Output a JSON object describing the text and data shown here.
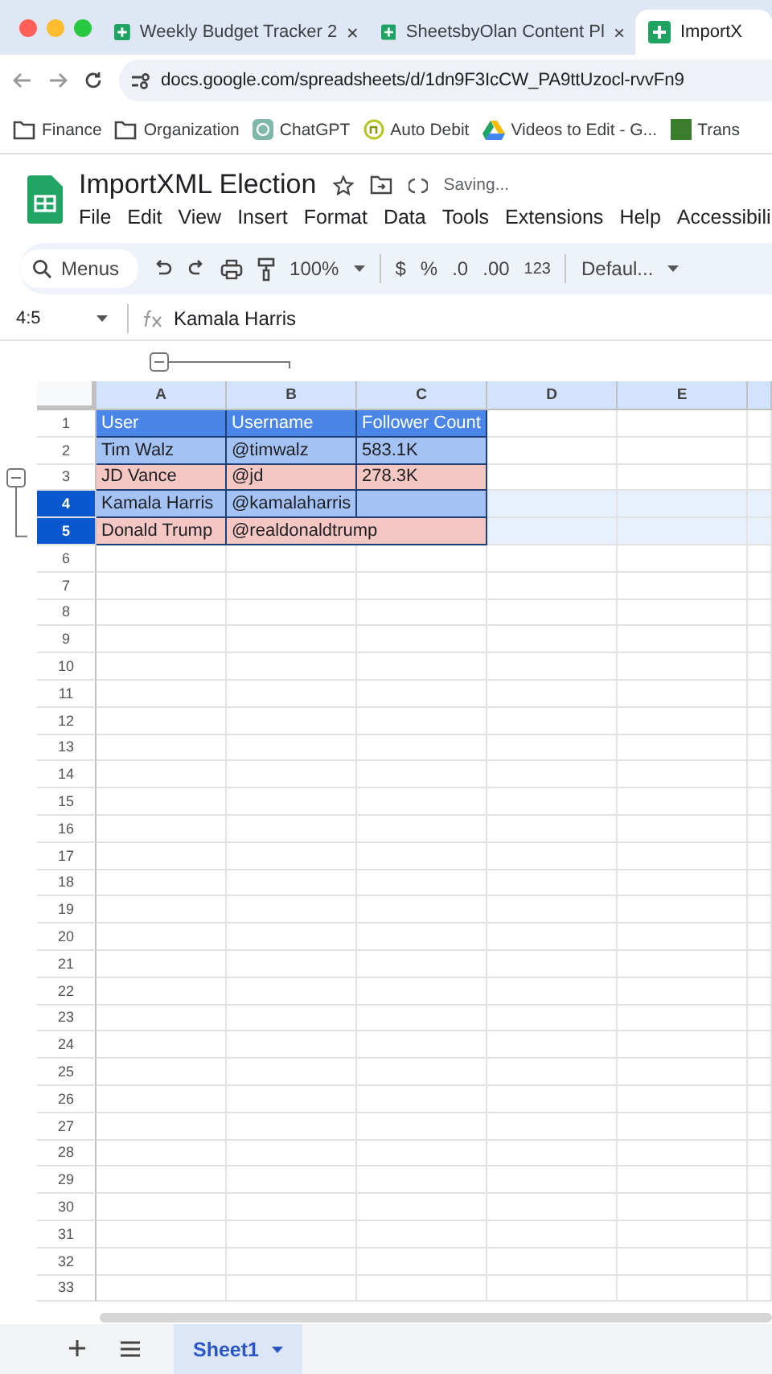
{
  "browser": {
    "tabs": [
      {
        "title": "Weekly Budget Tracker 2",
        "selected": false
      },
      {
        "title": "SheetsbyOlan Content Pl",
        "selected": false
      },
      {
        "title": "ImportX",
        "selected": true
      }
    ],
    "url": "docs.google.com/spreadsheets/d/1dn9F3IcCW_PA9ttUzocl-rvvFn9",
    "bookmarks": [
      {
        "label": "Finance",
        "kind": "folder"
      },
      {
        "label": "Organization",
        "kind": "folder"
      },
      {
        "label": "ChatGPT",
        "kind": "app"
      },
      {
        "label": "Auto Debit",
        "kind": "letter"
      },
      {
        "label": "Videos to Edit - G...",
        "kind": "drive"
      },
      {
        "label": "Trans",
        "kind": "square"
      }
    ]
  },
  "doc": {
    "title": "ImportXML Election",
    "status": "Saving...",
    "menu": [
      "File",
      "Edit",
      "View",
      "Insert",
      "Format",
      "Data",
      "Tools",
      "Extensions",
      "Help",
      "Accessibili"
    ]
  },
  "toolbar": {
    "search": "Menus",
    "zoom": "100%",
    "currency": "$",
    "percent": "%",
    "decrease_decimal": ".0",
    "increase_decimal": ".00",
    "number_format": "123",
    "font": "Defaul..."
  },
  "formula_bar": {
    "cell_ref": "4:5",
    "value": "Kamala Harris"
  },
  "grid": {
    "columns": [
      "A",
      "B",
      "C",
      "D",
      "E"
    ],
    "rows": [
      {
        "number": "1",
        "kind": "header",
        "color": "#4a86e8",
        "selected": false,
        "cells": [
          "User",
          "Username",
          "Follower Count"
        ]
      },
      {
        "number": "2",
        "kind": "data",
        "color": "#a4c2f4",
        "selected": false,
        "cells": [
          "Tim Walz",
          "@timwalz",
          "583.1K"
        ]
      },
      {
        "number": "3",
        "kind": "data",
        "color": "#f4c7c3",
        "selected": false,
        "cells": [
          "JD Vance",
          "@jd",
          "278.3K"
        ]
      },
      {
        "number": "4",
        "kind": "data",
        "color": "#a4c2f4",
        "selected": true,
        "cells": [
          "Kamala Harris",
          "@kamalaharris"
        ]
      },
      {
        "number": "5",
        "kind": "data",
        "color": "#f4c7c3",
        "selected": true,
        "cells": [
          "Donald Trump",
          "@realdonaldtrump"
        ]
      },
      {
        "number": "6",
        "selected": false
      },
      {
        "number": "7",
        "selected": false
      },
      {
        "number": "8",
        "selected": false
      },
      {
        "number": "9",
        "selected": false
      },
      {
        "number": "10",
        "selected": false
      },
      {
        "number": "11",
        "selected": false
      },
      {
        "number": "12",
        "selected": false
      },
      {
        "number": "13",
        "selected": false
      },
      {
        "number": "14",
        "selected": false
      },
      {
        "number": "15",
        "selected": false
      },
      {
        "number": "16",
        "selected": false
      },
      {
        "number": "17",
        "selected": false
      },
      {
        "number": "18",
        "selected": false
      },
      {
        "number": "19",
        "selected": false
      },
      {
        "number": "20",
        "selected": false
      },
      {
        "number": "21",
        "selected": false
      },
      {
        "number": "22",
        "selected": false
      },
      {
        "number": "23",
        "selected": false
      },
      {
        "number": "24",
        "selected": false
      },
      {
        "number": "25",
        "selected": false
      },
      {
        "number": "26",
        "selected": false
      },
      {
        "number": "27",
        "selected": false
      },
      {
        "number": "28",
        "selected": false
      },
      {
        "number": "29",
        "selected": false
      },
      {
        "number": "30",
        "selected": false
      },
      {
        "number": "31",
        "selected": false
      },
      {
        "number": "32",
        "selected": false
      },
      {
        "number": "33",
        "selected": false
      }
    ]
  },
  "sheets": [
    {
      "name": "Sheet1",
      "selected": true
    }
  ]
}
